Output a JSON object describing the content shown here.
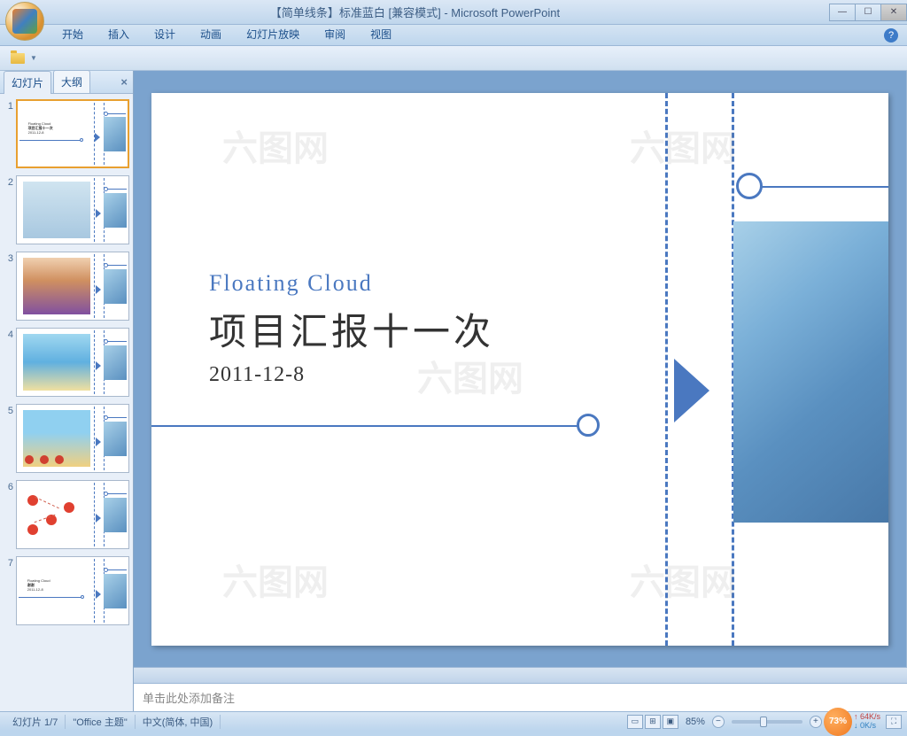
{
  "window": {
    "title": "【简单线条】标准蓝白 [兼容模式] - Microsoft PowerPoint"
  },
  "ribbon": {
    "tabs": [
      "开始",
      "插入",
      "设计",
      "动画",
      "幻灯片放映",
      "审阅",
      "视图"
    ]
  },
  "panel": {
    "tab_slides": "幻灯片",
    "tab_outline": "大纲"
  },
  "slide": {
    "subtitle": "Floating Cloud",
    "title": "项目汇报十一次",
    "date": "2011-12-8"
  },
  "thumbs": {
    "s1_sub": "Floating Cloud",
    "s1_title": "项目汇报十一次",
    "s1_date": "2011-12-8",
    "s7_sub": "Floating Cloud",
    "s7_title": "谢谢",
    "s7_date": "2011-12-8"
  },
  "notes": {
    "placeholder": "单击此处添加备注"
  },
  "status": {
    "slide_pos": "幻灯片 1/7",
    "theme": "\"Office 主题\"",
    "lang": "中文(简体, 中国)",
    "zoom": "85%",
    "badge": "73%",
    "net_up": "64K/s",
    "net_down": "0K/s"
  }
}
